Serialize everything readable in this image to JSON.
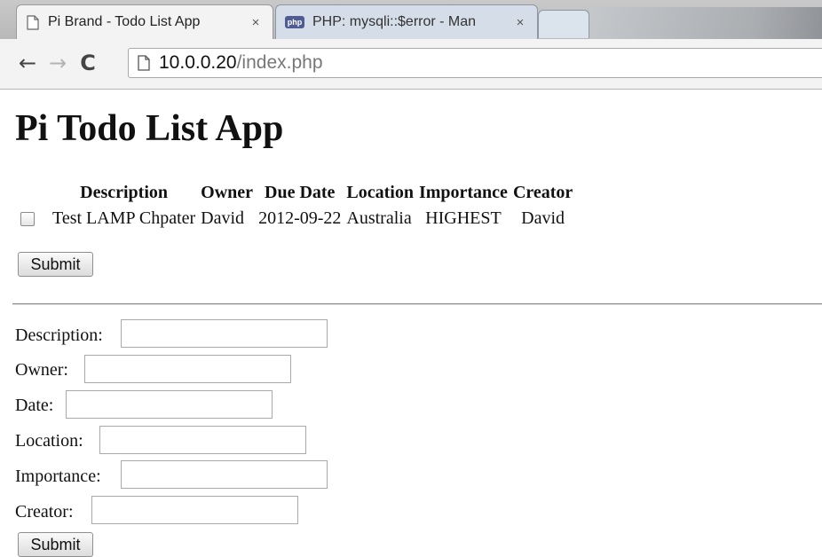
{
  "browser": {
    "tabs": [
      {
        "title": "Pi Brand - Todo List App",
        "close": "×",
        "favicon": "page-icon"
      },
      {
        "title": "PHP: mysqli::$error - Man",
        "close": "×",
        "favicon": "php-icon",
        "favicon_text": "php"
      }
    ],
    "nav": {
      "back": "←",
      "forward": "→",
      "reload": "C"
    },
    "address": {
      "host": "10.0.0.20",
      "path": "/index.php"
    }
  },
  "page": {
    "title": "Pi Todo List App",
    "table": {
      "columns": [
        "Description",
        "Owner",
        "Due Date",
        "Location",
        "Importance",
        "Creator"
      ],
      "rows": [
        {
          "description": "Test LAMP Chpater",
          "owner": "David",
          "due_date": "2012-09-22",
          "location": "Australia",
          "importance": "HIGHEST",
          "creator": "David"
        }
      ]
    },
    "submit_top": "Submit",
    "form": {
      "description_label": "Description:",
      "owner_label": "Owner:",
      "date_label": "Date:",
      "location_label": "Location:",
      "importance_label": "Importance:",
      "creator_label": "Creator:",
      "submit": "Submit"
    }
  }
}
